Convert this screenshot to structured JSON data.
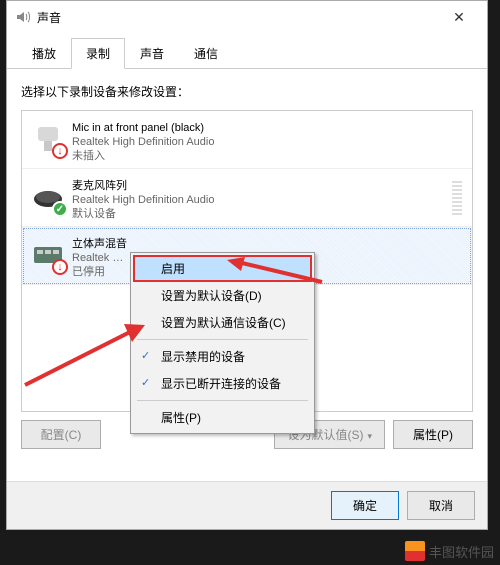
{
  "window": {
    "title": "声音"
  },
  "tabs": [
    {
      "label": "播放"
    },
    {
      "label": "录制"
    },
    {
      "label": "声音"
    },
    {
      "label": "通信"
    }
  ],
  "instruction": "选择以下录制设备来修改设置：",
  "devices": [
    {
      "name": "Mic in at front panel (black)",
      "sub": "Realtek High Definition Audio",
      "status": "未插入"
    },
    {
      "name": "麦克风阵列",
      "sub": "Realtek High Definition Audio",
      "status": "默认设备"
    },
    {
      "name": "立体声混音",
      "sub": "Realtek …",
      "status": "已停用"
    }
  ],
  "context_menu": {
    "enable": "启用",
    "set_default": "设置为默认设备(D)",
    "set_default_comm": "设置为默认通信设备(C)",
    "show_disabled": "显示禁用的设备",
    "show_disconnected": "显示已断开连接的设备",
    "properties": "属性(P)"
  },
  "buttons": {
    "configure": "配置(C)",
    "set_default_btn": "设为默认值(S)",
    "properties": "属性(P)",
    "ok": "确定",
    "cancel": "取消"
  },
  "watermark": "丰图软件园"
}
